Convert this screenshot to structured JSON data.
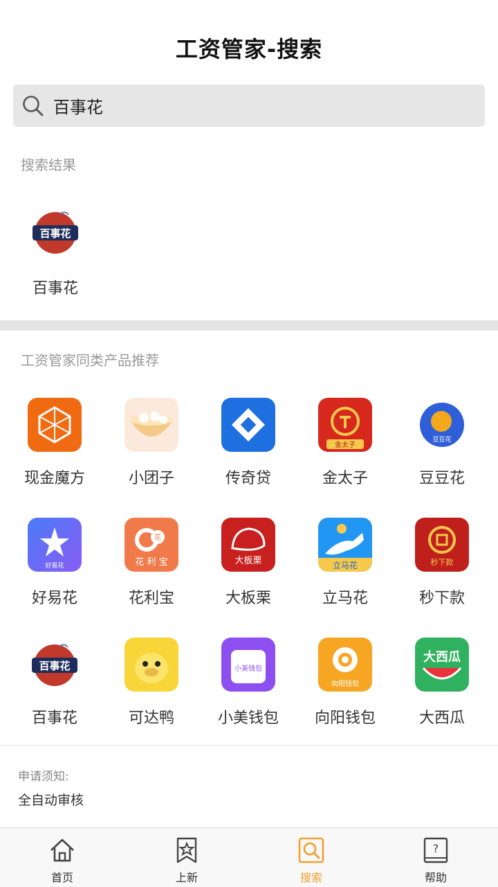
{
  "header": {
    "title": "工资管家-搜索"
  },
  "search": {
    "value": "百事花"
  },
  "results": {
    "label": "搜索结果",
    "items": [
      {
        "name": "百事花",
        "icon": "baishihua-logo"
      }
    ]
  },
  "recommend": {
    "label": "工资管家同类产品推荐",
    "rows": [
      [
        {
          "name": "现金魔方",
          "icon": "cube-logo"
        },
        {
          "name": "小团子",
          "icon": "dumpling-bowl-logo"
        },
        {
          "name": "传奇贷",
          "icon": "blue-diamond-logo"
        },
        {
          "name": "金太子",
          "icon": "gold-coin-logo",
          "icon_text": "金太子"
        },
        {
          "name": "豆豆花",
          "icon": "orange-circle-logo",
          "icon_text": "豆豆花"
        }
      ],
      [
        {
          "name": "好易花",
          "icon": "star-swirl-logo",
          "icon_text": "好易花"
        },
        {
          "name": "花利宝",
          "icon": "flower-coin-logo",
          "icon_text": "花 利 宝",
          "icon_badge": "花"
        },
        {
          "name": "大板栗",
          "icon": "chestnut-logo",
          "icon_text": "大板栗"
        },
        {
          "name": "立马花",
          "icon": "horse-logo",
          "icon_text": "立马花"
        },
        {
          "name": "秒下款",
          "icon": "red-coin-logo",
          "icon_text": "秒下款"
        }
      ],
      [
        {
          "name": "百事花",
          "icon": "baishihua-logo"
        },
        {
          "name": "可达鸭",
          "icon": "duck-logo"
        },
        {
          "name": "小美钱包",
          "icon": "purple-bag-logo",
          "icon_text": "小美钱包"
        },
        {
          "name": "向阳钱包",
          "icon": "sunflower-logo",
          "icon_text": "向阳钱包"
        },
        {
          "name": "大西瓜",
          "icon": "watermelon-logo",
          "icon_text": "大西瓜"
        }
      ]
    ]
  },
  "notice": {
    "title": "申请须知:",
    "text": "全自动审核"
  },
  "tabs": [
    {
      "label": "首页",
      "icon": "home-icon",
      "active": false
    },
    {
      "label": "上新",
      "icon": "star-bookmark-icon",
      "active": false
    },
    {
      "label": "搜索",
      "icon": "search-icon",
      "active": true
    },
    {
      "label": "帮助",
      "icon": "help-icon",
      "active": false
    }
  ],
  "colors": {
    "accent": "#f0a030",
    "divider": "#e4e4e4",
    "search_bg": "#e6e6e6"
  }
}
